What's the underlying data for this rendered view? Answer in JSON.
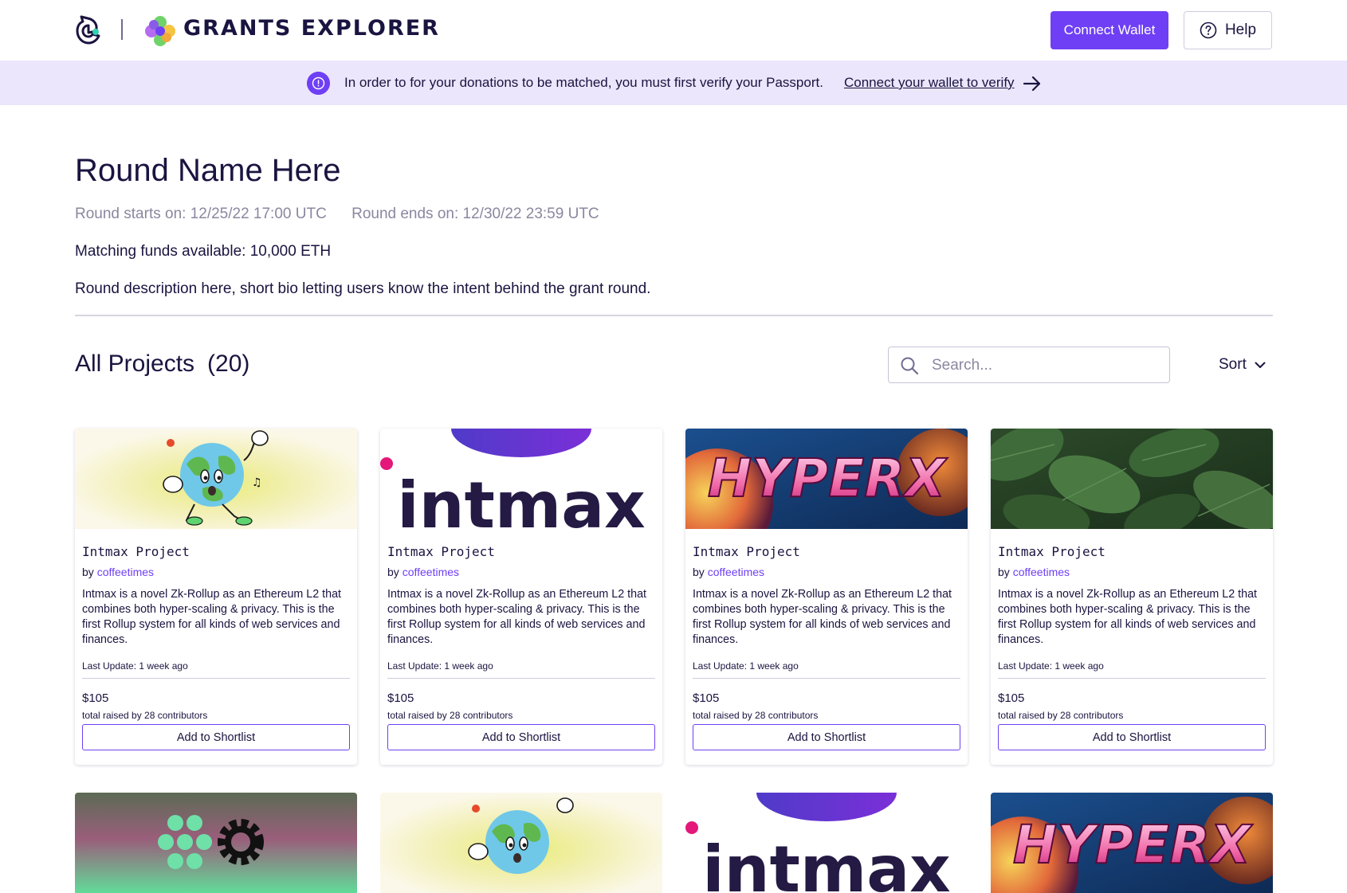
{
  "header": {
    "brand": "GRANTS EXPLORER",
    "connect_wallet": "Connect Wallet",
    "help": "Help"
  },
  "banner": {
    "text": "In order to for your donations to be matched, you must first verify your Passport.",
    "link": "Connect your wallet to verify"
  },
  "round": {
    "title": "Round Name Here",
    "starts": "Round starts on: 12/25/22  17:00 UTC",
    "ends": "Round ends on: 12/30/22  23:59 UTC",
    "matching": "Matching funds available: 10,000 ETH",
    "description": "Round description here, short bio letting users know the intent behind the grant round."
  },
  "projects": {
    "heading": "All Projects",
    "count": "(20)",
    "search_placeholder": "Search...",
    "sort_label": "Sort"
  },
  "cards": [
    {
      "image": "cartoon-earth",
      "title": "Intmax Project",
      "by": "by",
      "author": "coffeetimes",
      "description": "Intmax is a novel Zk-Rollup as an Ethereum L2 that combines both hyper-scaling & privacy. This is the first Rollup system for all kinds of web services and finances.",
      "last_update": "Last Update: 1 week ago",
      "amount": "$105",
      "contributors": "total raised by 28 contributors",
      "button": "Add to Shortlist"
    },
    {
      "image": "intmax-logo",
      "logo_text": "intmax",
      "title": "Intmax Project",
      "by": "by",
      "author": "coffeetimes",
      "description": "Intmax is a novel Zk-Rollup as an Ethereum L2 that combines both hyper-scaling & privacy. This is the first Rollup system for all kinds of web services and finances.",
      "last_update": "Last Update: 1 week ago",
      "amount": "$105",
      "contributors": "total raised by 28 contributors",
      "button": "Add to Shortlist"
    },
    {
      "image": "hyperx-logo",
      "logo_text": "HYPERX",
      "title": "Intmax Project",
      "by": "by",
      "author": "coffeetimes",
      "description": "Intmax is a novel Zk-Rollup as an Ethereum L2 that combines both hyper-scaling & privacy. This is the first Rollup system for all kinds of web services and finances.",
      "last_update": "Last Update: 1 week ago",
      "amount": "$105",
      "contributors": "total raised by 28 contributors",
      "button": "Add to Shortlist"
    },
    {
      "image": "leaves",
      "title": "Intmax Project",
      "by": "by",
      "author": "coffeetimes",
      "description": "Intmax is a novel Zk-Rollup as an Ethereum L2 that combines both hyper-scaling & privacy. This is the first Rollup system for all kinds of web services and finances.",
      "last_update": "Last Update: 1 week ago",
      "amount": "$105",
      "contributors": "total raised by 28 contributors",
      "button": "Add to Shortlist"
    }
  ],
  "bottom_cards": [
    {
      "image": "dots-gear-logo"
    },
    {
      "image": "cartoon-earth"
    },
    {
      "image": "intmax-logo",
      "logo_text": "intmax"
    },
    {
      "image": "hyperx-logo",
      "logo_text": "HYPERX"
    }
  ],
  "colors": {
    "accent": "#6f3ff5",
    "text": "#1a1440",
    "muted": "#8a879f",
    "banner_bg": "#ebe6fb"
  }
}
